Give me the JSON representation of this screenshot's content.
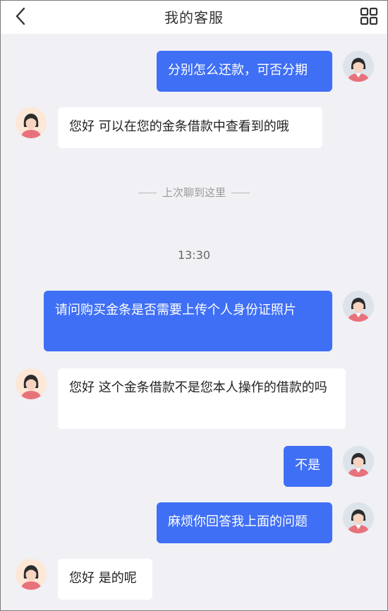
{
  "header": {
    "title": "我的客服",
    "back_icon": "chevron-left-icon",
    "menu_icon": "grid-icon"
  },
  "colors": {
    "outgoing_bubble": "#3f6ff5",
    "incoming_bubble": "#ffffff",
    "background": "#f1f0f5"
  },
  "messages": [
    {
      "from": "user",
      "text": "分别怎么还款，可否分期"
    },
    {
      "from": "agent",
      "text": "您好 可以在您的金条借款中查看到的哦"
    },
    {
      "from": "user",
      "text": "请问购买金条是否需要上传个人身份证照片"
    },
    {
      "from": "agent",
      "text": "您好 这个金条借款不是您本人操作的借款的吗"
    },
    {
      "from": "user",
      "text": "不是"
    },
    {
      "from": "user",
      "text": "麻烦你回答我上面的问题"
    },
    {
      "from": "agent",
      "text": "您好 是的呢"
    }
  ],
  "divider_text": "上次聊到这里",
  "timestamp": "13:30"
}
